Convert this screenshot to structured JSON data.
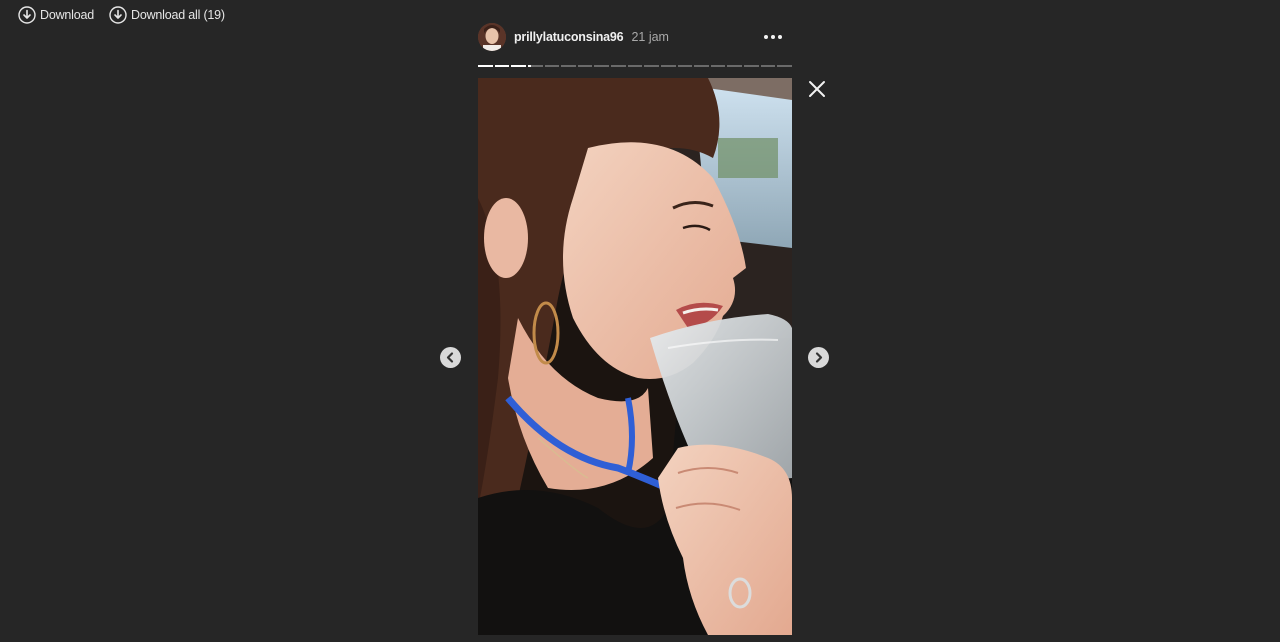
{
  "toolbar": {
    "download_label": "Download",
    "download_all_label": "Download all (19)",
    "download_icon": "download-circle-icon"
  },
  "story": {
    "username": "prillylatuconsina96",
    "time": "21 jam",
    "total_segments": 19,
    "progress": [
      1,
      1,
      1,
      0.2,
      0,
      0,
      0,
      0,
      0,
      0,
      0,
      0,
      0,
      0,
      0,
      0,
      0,
      0,
      0
    ],
    "media_alt": "Woman in a car holding a clear pouch, wearing hoop earring and blue lanyard"
  },
  "controls": {
    "close_icon": "close-icon",
    "prev_icon": "chevron-left-icon",
    "next_icon": "chevron-right-icon",
    "more_icon": "more-horizontal-icon"
  },
  "colors": {
    "background": "#262626",
    "text": "#e6e6e6",
    "progress_active": "#ffffff",
    "progress_inactive": "#6a6a6a",
    "lanyard": "#2f5fd6"
  }
}
